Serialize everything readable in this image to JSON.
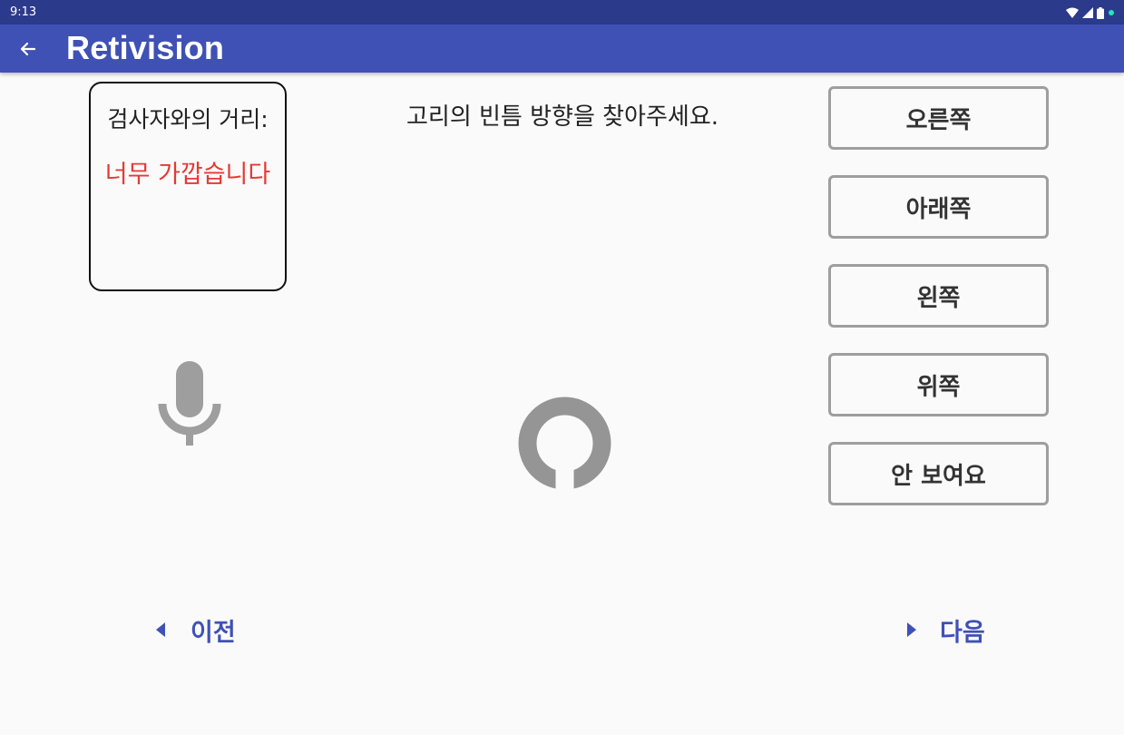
{
  "status_bar": {
    "time": "9:13",
    "icons": [
      "wifi-icon",
      "signal-icon",
      "battery-icon",
      "notification-dot-icon"
    ]
  },
  "app_bar": {
    "back_icon": "arrow-left-icon",
    "title": "Retivision",
    "color": "#3f51b5"
  },
  "distance": {
    "label": "검사자와의 거리:",
    "value": "너무 가깝습니다",
    "value_color": "#e53935"
  },
  "test": {
    "instruction": "고리의 빈틈 방향을 찾아주세요.",
    "microphone_icon": "microphone-icon",
    "optotype_icon": "landolt-c-ring-gap-down-icon"
  },
  "answers": [
    {
      "label": "오른쪽"
    },
    {
      "label": "아래쪽"
    },
    {
      "label": "왼쪽"
    },
    {
      "label": "위쪽"
    },
    {
      "label": "안 보여요"
    }
  ],
  "navigation": {
    "prev_label": "이전",
    "next_label": "다음",
    "prev_icon": "caret-left-icon",
    "next_icon": "caret-right-icon"
  }
}
